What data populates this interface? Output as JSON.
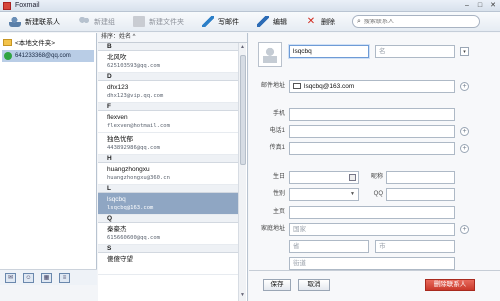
{
  "window": {
    "title": "Foxmail"
  },
  "toolbar": {
    "new_contact": "新建联系人",
    "new_group": "新建组",
    "new_folder": "新建文件夹",
    "write_mail": "写邮件",
    "edit": "编辑",
    "delete": "删除",
    "search_placeholder": "搜索联系人"
  },
  "sidebar": {
    "folder": "<本地文件夹>",
    "account": "641233368@qq.com"
  },
  "list": {
    "sort_label": "排序：姓名 ^",
    "groups": [
      {
        "letter": "B",
        "contacts": [
          {
            "name": "北风吹",
            "email": "625103593@qq.com"
          }
        ]
      },
      {
        "letter": "D",
        "contacts": [
          {
            "name": "dhx123",
            "email": "dhx123@vip.qq.com"
          }
        ]
      },
      {
        "letter": "F",
        "contacts": [
          {
            "name": "flexven",
            "email": "flexven@hotmail.com"
          },
          {
            "name": "独色忧郁",
            "email": "443892986@qq.com"
          }
        ]
      },
      {
        "letter": "H",
        "contacts": [
          {
            "name": "huangzhongxu",
            "email": "huangzhongxu@360.cn"
          }
        ]
      },
      {
        "letter": "L",
        "contacts": [
          {
            "name": "lsqcbq",
            "email": "lsqcbq@163.com",
            "selected": true
          }
        ]
      },
      {
        "letter": "Q",
        "contacts": [
          {
            "name": "秦豪杰",
            "email": "615660600@qq.com"
          }
        ]
      },
      {
        "letter": "S",
        "contacts": [
          {
            "name": "傻傻守望",
            "email": ""
          }
        ]
      }
    ]
  },
  "detail": {
    "first_name": "lsqcbq",
    "last_name_placeholder": "名",
    "email_label": "邮件地址",
    "email": "lsqcbq@163.com",
    "mobile_label": "手机",
    "phone_label": "电话1",
    "fax_label": "传真1",
    "birthday_label": "生日",
    "nickname_label": "昵称",
    "gender_label": "性别",
    "qq_label": "QQ",
    "homepage_label": "主页",
    "address_label": "家庭地址",
    "country_placeholder": "国家",
    "province_placeholder": "省",
    "city_placeholder": "市",
    "street_placeholder": "街道",
    "save": "保存",
    "cancel": "取消",
    "delete_contact": "删除联系人"
  }
}
